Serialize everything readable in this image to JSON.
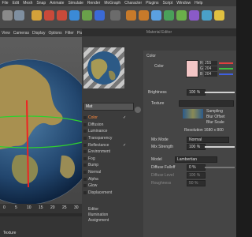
{
  "menu": [
    "File",
    "Edit",
    "Mesh",
    "Snap",
    "Animate",
    "Simulate",
    "Render",
    "MoGraph",
    "Character",
    "Plugins",
    "Script",
    "Window",
    "Help"
  ],
  "viewport_menu": [
    "View",
    "Cameras",
    "Display",
    "Options",
    "Filter",
    "Panel"
  ],
  "timeline": {
    "ticks": [
      "0",
      "5",
      "10",
      "15",
      "20",
      "25",
      "30"
    ],
    "object_label": "Texture"
  },
  "material_editor": {
    "title": "Material Editor",
    "material_name": "Mat",
    "channels": [
      {
        "label": "Color",
        "checked": true,
        "active": true
      },
      {
        "label": "Diffusion",
        "checked": false
      },
      {
        "label": "Luminance",
        "checked": false
      },
      {
        "label": "Transparency",
        "checked": false
      },
      {
        "label": "Reflectance",
        "checked": true
      },
      {
        "label": "Environment",
        "checked": false
      },
      {
        "label": "Fog",
        "checked": false
      },
      {
        "label": "Bump",
        "checked": false
      },
      {
        "label": "Normal",
        "checked": false
      },
      {
        "label": "Alpha",
        "checked": false
      },
      {
        "label": "Glow",
        "checked": false
      },
      {
        "label": "Displacement",
        "checked": false
      }
    ],
    "extra_items": [
      "Editor",
      "Illumination",
      "Assignment"
    ],
    "panel": {
      "section": "Color",
      "color_label": "Color",
      "rgb": [
        {
          "k": "R",
          "v": "255"
        },
        {
          "k": "G",
          "v": "204"
        },
        {
          "k": "B",
          "v": "204"
        }
      ],
      "swatch_color": "#f3c6c6",
      "brightness_label": "Brightness",
      "brightness_value": "100 %",
      "texture_label": "Texture",
      "sampling_label": "Sampling",
      "blur_offset_label": "Blur Offset",
      "blur_scale_label": "Blur Scale",
      "resolution": "Resolution 1680 x 800",
      "mix_mode_label": "Mix Mode",
      "mix_mode_value": "Normal",
      "mix_strength_label": "Mix Strength",
      "mix_strength_value": "100 %",
      "model_label": "Model",
      "model_value": "Lambertian",
      "diffuse_falloff_label": "Diffuse Falloff",
      "diffuse_falloff_value": "0 %",
      "diffuse_level_label": "Diffuse Level",
      "diffuse_level_value": "100 %",
      "roughness_label": "Roughness",
      "roughness_value": "50 %"
    }
  }
}
